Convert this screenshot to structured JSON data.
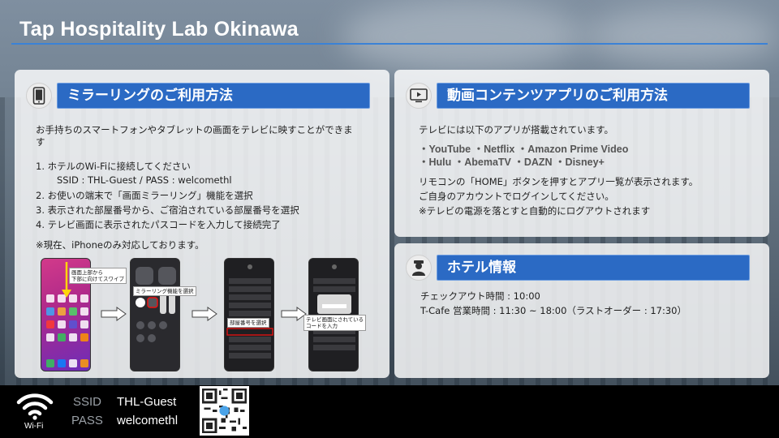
{
  "header": {
    "title": "Tap Hospitality Lab Okinawa"
  },
  "mirroring": {
    "icon": "smartphone-icon",
    "heading": "ミラーリングのご利用方法",
    "intro_line1": "お手持ちのスマートフォンやタブレットの画面をテレビに映すことができま",
    "intro_line2": "す",
    "steps": [
      "1. ホテルのWi-Fiに接続してください",
      "SSID : THL-Guest  /  PASS : welcomethl",
      "2. お使いの端末で「画面ミラーリング」機能を選択",
      "3. 表示された部屋番号から、ご宿泊されている部屋番号を選択",
      "4. テレビ画面に表示されたパスコードを入力して接続完了"
    ],
    "note": "※現在、iPhoneのみ対応しております。",
    "callouts": {
      "swipe_1": "画面上部から",
      "swipe_2": "下部に向けてスワイプ",
      "mirror": "ミラーリング機能を選択",
      "room": "部屋番号を選択",
      "code_1": "テレビ画面にされている",
      "code_2": "コードを入力"
    }
  },
  "video": {
    "icon": "tv-icon",
    "heading": "動画コンテンツアプリのご利用方法",
    "line1": "テレビには以下のアプリが搭載されています。",
    "apps_line1": "・YouTube ・Netflix ・Amazon Prime Video",
    "apps_line2": "・Hulu ・AbemaTV ・DAZN ・Disney+",
    "line2": "リモコンの「HOME」ボタンを押すとアプリ一覧が表示されます。",
    "line3": "ご自身のアカウントでログインしてください。",
    "line4": "※テレビの電源を落とすと自動的にログアウトされます"
  },
  "hotel": {
    "icon": "concierge-icon",
    "heading": "ホテル情報",
    "checkout": "チェックアウト時間 : 10:00",
    "cafe": "T-Cafe 営業時間 : 11:30 ~ 18:00（ラストオーダー : 17:30）"
  },
  "footer": {
    "wifi_label": "Wi-Fi",
    "ssid_key": "SSID",
    "ssid_value": "THL-Guest",
    "pass_key": "PASS",
    "pass_value": "welcomethl"
  },
  "colors": {
    "accent": "#2b6ac4",
    "rule": "#3b82d6"
  }
}
